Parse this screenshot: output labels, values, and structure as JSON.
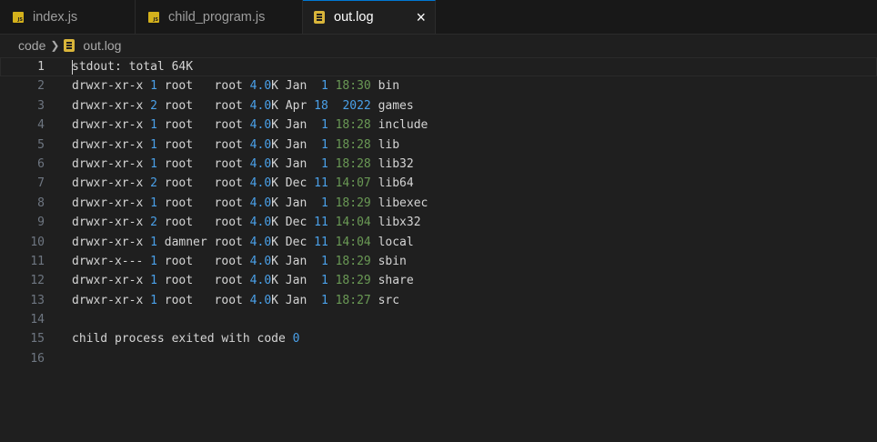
{
  "tabs": [
    {
      "label": "index.js",
      "icon": "js-file-icon",
      "active": false
    },
    {
      "label": "child_program.js",
      "icon": "js-file-icon",
      "active": false
    },
    {
      "label": "out.log",
      "icon": "log-file-icon",
      "active": true,
      "close": "×"
    }
  ],
  "breadcrumb": {
    "folder": "code",
    "file": "out.log"
  },
  "editor": {
    "current_line": 1,
    "lines": [
      {
        "n": "1",
        "parts": [
          {
            "t": "stdout: total 64K",
            "c": ""
          }
        ]
      },
      {
        "n": "2",
        "parts": [
          {
            "t": "drwxr-xr-x ",
            "c": ""
          },
          {
            "t": "1",
            "c": "num"
          },
          {
            "t": " root   root ",
            "c": ""
          },
          {
            "t": "4.0",
            "c": "num"
          },
          {
            "t": "K Jan  ",
            "c": ""
          },
          {
            "t": "1",
            "c": "num"
          },
          {
            "t": " ",
            "c": ""
          },
          {
            "t": "18:30",
            "c": "time"
          },
          {
            "t": " bin",
            "c": ""
          }
        ]
      },
      {
        "n": "3",
        "parts": [
          {
            "t": "drwxr-xr-x ",
            "c": ""
          },
          {
            "t": "2",
            "c": "num"
          },
          {
            "t": " root   root ",
            "c": ""
          },
          {
            "t": "4.0",
            "c": "num"
          },
          {
            "t": "K Apr ",
            "c": ""
          },
          {
            "t": "18",
            "c": "num"
          },
          {
            "t": "  ",
            "c": ""
          },
          {
            "t": "2022",
            "c": "num"
          },
          {
            "t": " games",
            "c": ""
          }
        ]
      },
      {
        "n": "4",
        "parts": [
          {
            "t": "drwxr-xr-x ",
            "c": ""
          },
          {
            "t": "1",
            "c": "num"
          },
          {
            "t": " root   root ",
            "c": ""
          },
          {
            "t": "4.0",
            "c": "num"
          },
          {
            "t": "K Jan  ",
            "c": ""
          },
          {
            "t": "1",
            "c": "num"
          },
          {
            "t": " ",
            "c": ""
          },
          {
            "t": "18:28",
            "c": "time"
          },
          {
            "t": " include",
            "c": ""
          }
        ]
      },
      {
        "n": "5",
        "parts": [
          {
            "t": "drwxr-xr-x ",
            "c": ""
          },
          {
            "t": "1",
            "c": "num"
          },
          {
            "t": " root   root ",
            "c": ""
          },
          {
            "t": "4.0",
            "c": "num"
          },
          {
            "t": "K Jan  ",
            "c": ""
          },
          {
            "t": "1",
            "c": "num"
          },
          {
            "t": " ",
            "c": ""
          },
          {
            "t": "18:28",
            "c": "time"
          },
          {
            "t": " lib",
            "c": ""
          }
        ]
      },
      {
        "n": "6",
        "parts": [
          {
            "t": "drwxr-xr-x ",
            "c": ""
          },
          {
            "t": "1",
            "c": "num"
          },
          {
            "t": " root   root ",
            "c": ""
          },
          {
            "t": "4.0",
            "c": "num"
          },
          {
            "t": "K Jan  ",
            "c": ""
          },
          {
            "t": "1",
            "c": "num"
          },
          {
            "t": " ",
            "c": ""
          },
          {
            "t": "18:28",
            "c": "time"
          },
          {
            "t": " lib32",
            "c": ""
          }
        ]
      },
      {
        "n": "7",
        "parts": [
          {
            "t": "drwxr-xr-x ",
            "c": ""
          },
          {
            "t": "2",
            "c": "num"
          },
          {
            "t": " root   root ",
            "c": ""
          },
          {
            "t": "4.0",
            "c": "num"
          },
          {
            "t": "K Dec ",
            "c": ""
          },
          {
            "t": "11",
            "c": "num"
          },
          {
            "t": " ",
            "c": ""
          },
          {
            "t": "14:07",
            "c": "time"
          },
          {
            "t": " lib64",
            "c": ""
          }
        ]
      },
      {
        "n": "8",
        "parts": [
          {
            "t": "drwxr-xr-x ",
            "c": ""
          },
          {
            "t": "1",
            "c": "num"
          },
          {
            "t": " root   root ",
            "c": ""
          },
          {
            "t": "4.0",
            "c": "num"
          },
          {
            "t": "K Jan  ",
            "c": ""
          },
          {
            "t": "1",
            "c": "num"
          },
          {
            "t": " ",
            "c": ""
          },
          {
            "t": "18:29",
            "c": "time"
          },
          {
            "t": " libexec",
            "c": ""
          }
        ]
      },
      {
        "n": "9",
        "parts": [
          {
            "t": "drwxr-xr-x ",
            "c": ""
          },
          {
            "t": "2",
            "c": "num"
          },
          {
            "t": " root   root ",
            "c": ""
          },
          {
            "t": "4.0",
            "c": "num"
          },
          {
            "t": "K Dec ",
            "c": ""
          },
          {
            "t": "11",
            "c": "num"
          },
          {
            "t": " ",
            "c": ""
          },
          {
            "t": "14:04",
            "c": "time"
          },
          {
            "t": " libx32",
            "c": ""
          }
        ]
      },
      {
        "n": "10",
        "parts": [
          {
            "t": "drwxr-xr-x ",
            "c": ""
          },
          {
            "t": "1",
            "c": "num"
          },
          {
            "t": " damner root ",
            "c": ""
          },
          {
            "t": "4.0",
            "c": "num"
          },
          {
            "t": "K Dec ",
            "c": ""
          },
          {
            "t": "11",
            "c": "num"
          },
          {
            "t": " ",
            "c": ""
          },
          {
            "t": "14:04",
            "c": "time"
          },
          {
            "t": " local",
            "c": ""
          }
        ]
      },
      {
        "n": "11",
        "parts": [
          {
            "t": "drwxr-x--- ",
            "c": ""
          },
          {
            "t": "1",
            "c": "num"
          },
          {
            "t": " root   root ",
            "c": ""
          },
          {
            "t": "4.0",
            "c": "num"
          },
          {
            "t": "K Jan  ",
            "c": ""
          },
          {
            "t": "1",
            "c": "num"
          },
          {
            "t": " ",
            "c": ""
          },
          {
            "t": "18:29",
            "c": "time"
          },
          {
            "t": " sbin",
            "c": ""
          }
        ]
      },
      {
        "n": "12",
        "parts": [
          {
            "t": "drwxr-xr-x ",
            "c": ""
          },
          {
            "t": "1",
            "c": "num"
          },
          {
            "t": " root   root ",
            "c": ""
          },
          {
            "t": "4.0",
            "c": "num"
          },
          {
            "t": "K Jan  ",
            "c": ""
          },
          {
            "t": "1",
            "c": "num"
          },
          {
            "t": " ",
            "c": ""
          },
          {
            "t": "18:29",
            "c": "time"
          },
          {
            "t": " share",
            "c": ""
          }
        ]
      },
      {
        "n": "13",
        "parts": [
          {
            "t": "drwxr-xr-x ",
            "c": ""
          },
          {
            "t": "1",
            "c": "num"
          },
          {
            "t": " root   root ",
            "c": ""
          },
          {
            "t": "4.0",
            "c": "num"
          },
          {
            "t": "K Jan  ",
            "c": ""
          },
          {
            "t": "1",
            "c": "num"
          },
          {
            "t": " ",
            "c": ""
          },
          {
            "t": "18:27",
            "c": "time"
          },
          {
            "t": " src",
            "c": ""
          }
        ]
      },
      {
        "n": "14",
        "parts": []
      },
      {
        "n": "15",
        "parts": [
          {
            "t": "child process exited with code ",
            "c": ""
          },
          {
            "t": "0",
            "c": "num"
          }
        ]
      },
      {
        "n": "16",
        "parts": []
      }
    ]
  },
  "colors": {
    "number": "#4aa0e8",
    "time": "#6a9955",
    "text": "#d4d4d4",
    "accent": "#0078d4"
  }
}
